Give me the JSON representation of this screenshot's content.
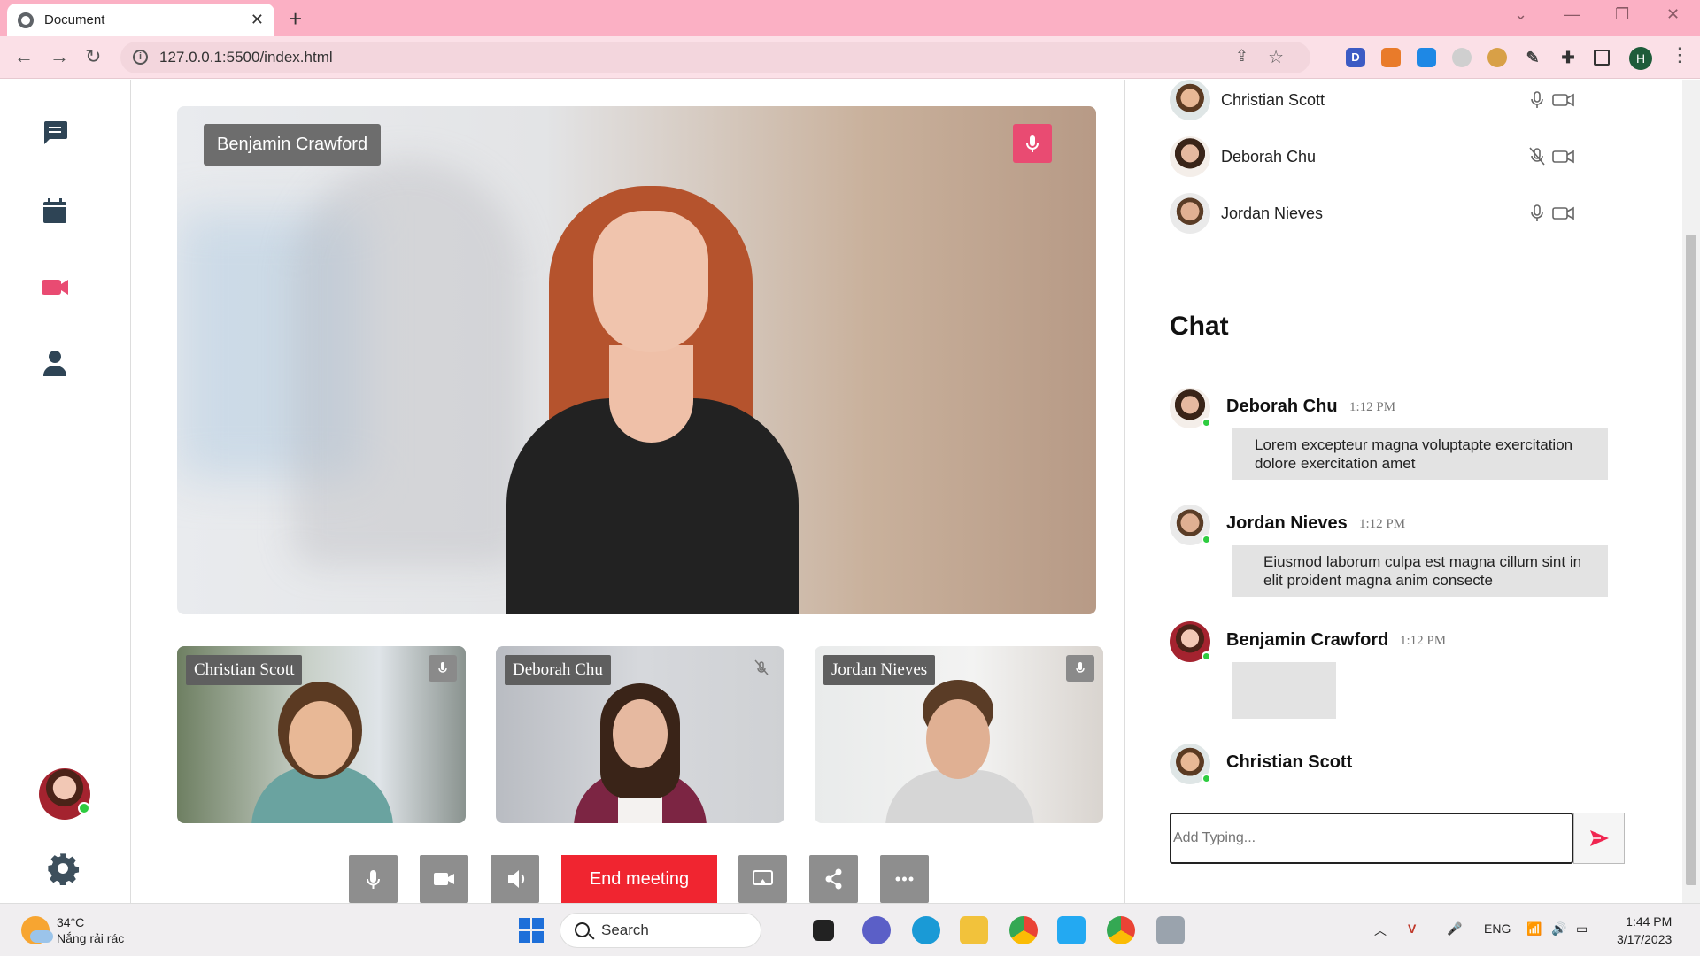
{
  "browser": {
    "tab_title": "Document",
    "url": "127.0.0.1:5500/index.html",
    "profile_initial": "H",
    "extensions": [
      {
        "name": "d-extension-icon",
        "label": "D",
        "color": "#3c5bc4"
      },
      {
        "name": "fox-extension-icon",
        "label": "",
        "color": "#e97b2a"
      },
      {
        "name": "drop-extension-icon",
        "label": "",
        "color": "#1e88e5"
      },
      {
        "name": "compass-extension-icon",
        "label": "",
        "color": "#cfcfcf"
      },
      {
        "name": "cookie-extension-icon",
        "label": "",
        "color": "#d8a047"
      }
    ]
  },
  "main_video": {
    "speaker_name": "Benjamin Crawford",
    "mic_color": "#e94b72"
  },
  "thumbnails": [
    {
      "name": "Christian Scott",
      "mic": "on"
    },
    {
      "name": "Deborah Chu",
      "mic": "off"
    },
    {
      "name": "Jordan Nieves",
      "mic": "on"
    }
  ],
  "controls": {
    "end_meeting_label": "End meeting",
    "end_color": "#f02530"
  },
  "participants": [
    {
      "name": "Christian Scott",
      "mic": "on"
    },
    {
      "name": "Deborah Chu",
      "mic": "off"
    },
    {
      "name": "Jordan Nieves",
      "mic": "on"
    }
  ],
  "chat": {
    "title": "Chat",
    "messages": [
      {
        "name": "Deborah Chu",
        "time": "1:12 PM",
        "text": "Lorem excepteur magna voluptapte exercitation dolore exercitation amet"
      },
      {
        "name": "Jordan Nieves",
        "time": "1:12 PM",
        "text": "Eiusmod laborum culpa est magna cillum sint in elit proident magna anim consecte"
      },
      {
        "name": "Benjamin Crawford",
        "time": "1:12 PM",
        "text": ""
      },
      {
        "name": "Christian Scott",
        "time": "",
        "text": ""
      }
    ],
    "input_placeholder": "Add Typing...",
    "send_color": "#f02550"
  },
  "taskbar": {
    "temperature": "34°C",
    "weather_desc": "Nắng rải rác",
    "search_label": "Search",
    "language": "ENG",
    "time": "1:44 PM",
    "date": "3/17/2023"
  },
  "accent_color": "#e94b72"
}
